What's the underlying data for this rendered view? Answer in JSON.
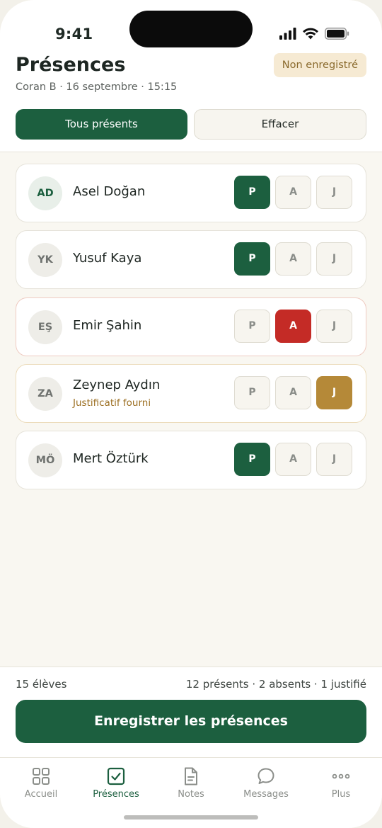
{
  "status_bar": {
    "time": "9:41"
  },
  "header": {
    "title": "Présences",
    "subtitle": "Coran B · 16 septembre · 15:15",
    "status_badge": "Non enregistré",
    "all_present_label": "Tous présents",
    "clear_label": "Effacer"
  },
  "students": [
    {
      "initials": "AD",
      "name": "Asel Doğan",
      "note": "",
      "status": "P"
    },
    {
      "initials": "YK",
      "name": "Yusuf Kaya",
      "note": "",
      "status": "P"
    },
    {
      "initials": "EŞ",
      "name": "Emir Şahin",
      "note": "",
      "status": "A"
    },
    {
      "initials": "ZA",
      "name": "Zeynep Aydın",
      "note": "Justificatif fourni",
      "status": "J"
    },
    {
      "initials": "MÖ",
      "name": "Mert Öztürk",
      "note": "",
      "status": "P"
    }
  ],
  "attendance_options": {
    "present": "P",
    "absent": "A",
    "justified": "J"
  },
  "footer": {
    "student_count": "15 élèves",
    "summary": "12 présents · 2 absents · 1 justifié",
    "save_label": "Enregistrer les présences"
  },
  "tabs": [
    {
      "label": "Accueil",
      "icon": "grid-icon",
      "active": false
    },
    {
      "label": "Présences",
      "icon": "checkbox-icon",
      "active": true
    },
    {
      "label": "Notes",
      "icon": "document-icon",
      "active": false
    },
    {
      "label": "Messages",
      "icon": "chat-bubble-icon",
      "active": false
    },
    {
      "label": "Plus",
      "icon": "more-dots-icon",
      "active": false
    }
  ],
  "colors": {
    "primary": "#1c5f3f",
    "absent": "#c42b26",
    "justified": "#b58938",
    "badge_bg": "#f6ead3"
  }
}
